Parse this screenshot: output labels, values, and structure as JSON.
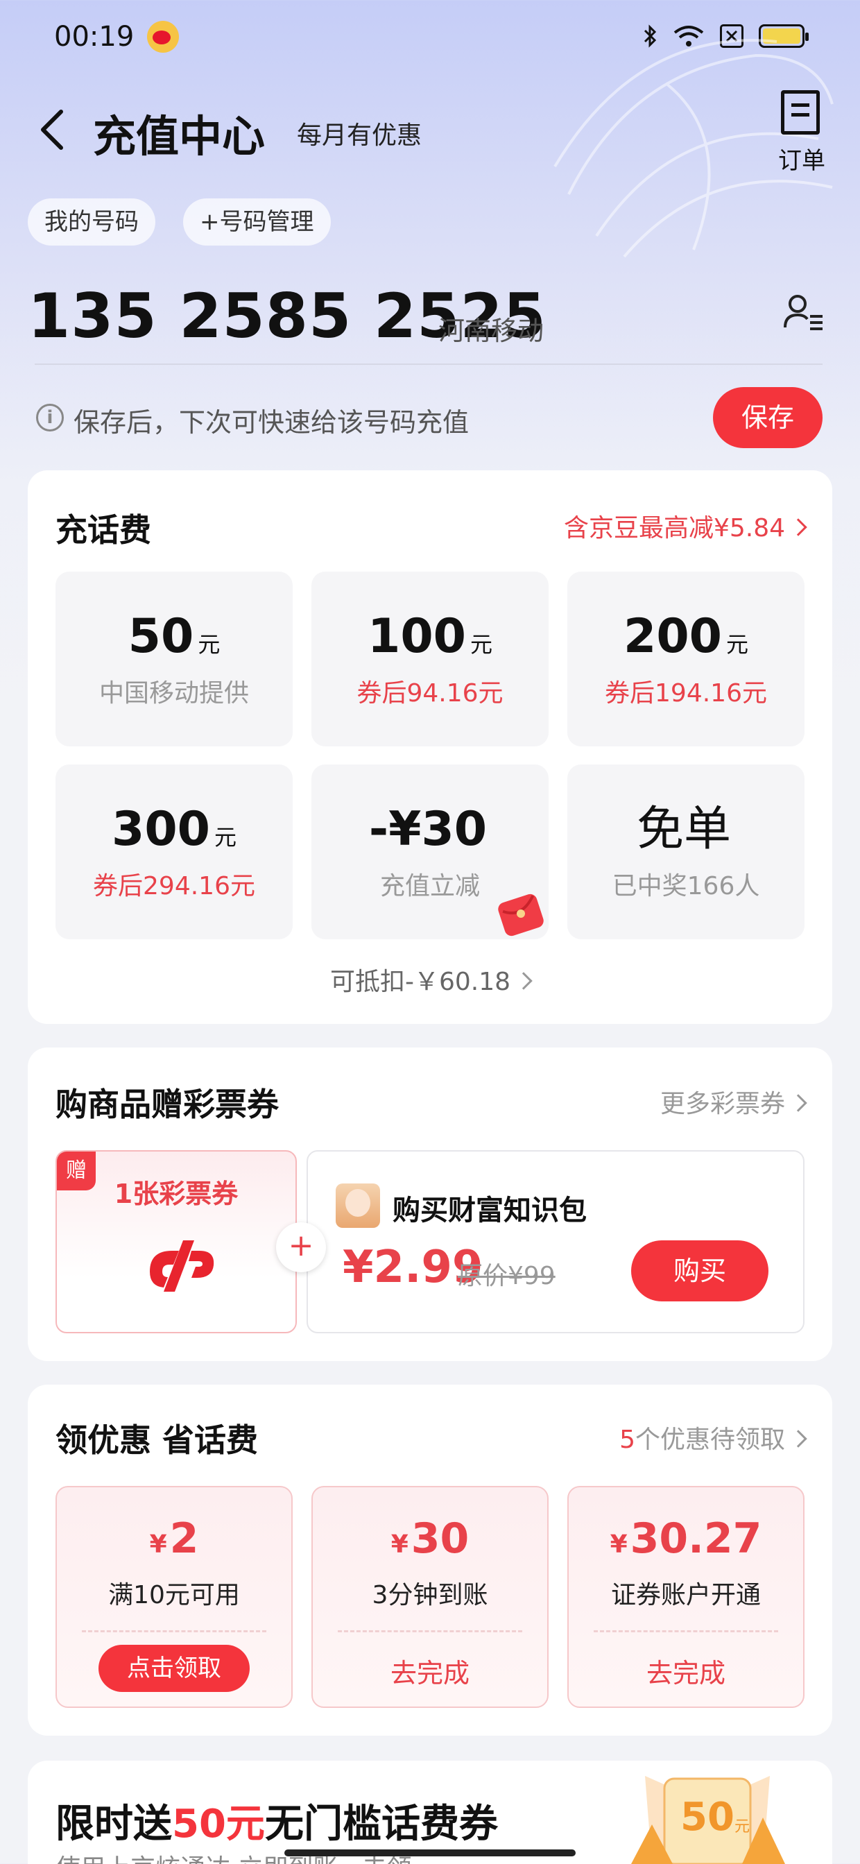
{
  "status_bar": {
    "time": "00:19"
  },
  "header": {
    "title": "充值中心",
    "subtitle": "每月有优惠",
    "order_label": "订单"
  },
  "chips": {
    "my_number": "我的号码",
    "manage": "+号码管理"
  },
  "account": {
    "phone": "135 2585 2525",
    "carrier": "河南移动"
  },
  "save_bar": {
    "hint": "保存后，下次可快速给该号码充值",
    "save_label": "保存"
  },
  "recharge": {
    "title": "充话费",
    "discount_link": "含京豆最高减¥5.84",
    "tiles": [
      {
        "amount": "50",
        "unit": "元",
        "sub": "中国移动提供"
      },
      {
        "amount": "100",
        "unit": "元",
        "sub": "券后94.16元"
      },
      {
        "amount": "200",
        "unit": "元",
        "sub": "券后194.16元"
      },
      {
        "amount": "300",
        "unit": "元",
        "sub": "券后294.16元"
      },
      {
        "amount": "-¥30",
        "unit": "",
        "sub": "充值立减"
      },
      {
        "amount": "免单",
        "unit": "",
        "sub": "已中奖166人"
      }
    ],
    "deductible": "可抵扣-￥60.18"
  },
  "lottery": {
    "title": "购商品赠彩票券",
    "more_link": "更多彩票券",
    "gift_badge": "赠",
    "gift_label": "1张彩票券",
    "plus": "+",
    "product_name": "购买财富知识包",
    "price": "¥2.99",
    "original_price": "原价¥99",
    "buy_label": "购买"
  },
  "coupons": {
    "title": "领优惠 省话费",
    "pending_count": "5",
    "pending_text": "个优惠待领取",
    "currency": "¥",
    "items": [
      {
        "value": "2",
        "condition": "满10元可用",
        "action": "点击领取"
      },
      {
        "value": "30",
        "condition": "3分钟到账",
        "action": "去完成"
      },
      {
        "value": "30.27",
        "condition": "证券账户开通",
        "action": "去完成"
      }
    ]
  },
  "promo": {
    "title_prefix": "限时送",
    "title_highlight": "50元",
    "title_suffix": "无门槛话费券",
    "subtitle": "使用上京炫通达 立即到账 · 去领",
    "badge_amount": "50",
    "badge_unit": "元"
  },
  "colors": {
    "accent_red": "#f4343c",
    "text_red": "#e8424a"
  }
}
